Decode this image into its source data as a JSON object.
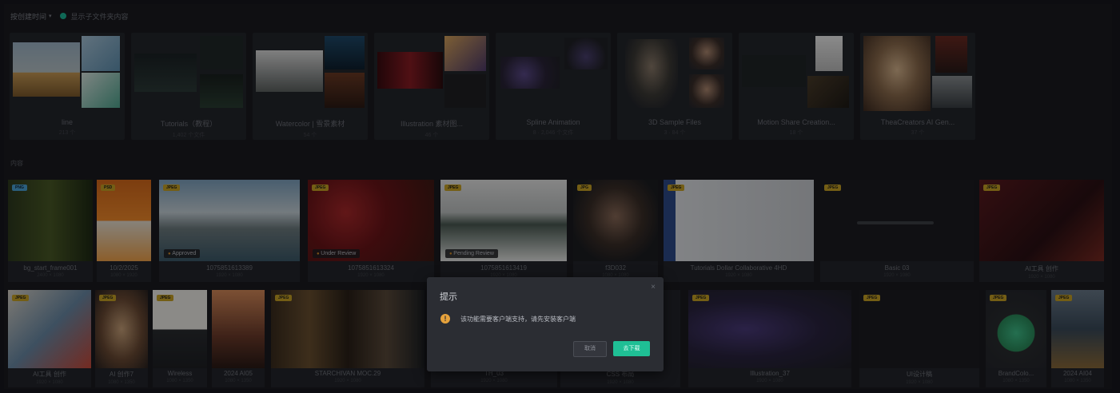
{
  "header": {
    "sort_label": "按创建时间",
    "toggle_label": "显示子文件夹内容"
  },
  "folders": [
    {
      "name": "line",
      "sub": "213 个"
    },
    {
      "name": "Tutorials（教程）",
      "sub": "1,402 个文件"
    },
    {
      "name": "Watercolor | 雪景素材",
      "sub": "54 个"
    },
    {
      "name": "Illustration 素材图...",
      "sub": "46 个"
    },
    {
      "name": "Spline Animation",
      "sub": "8 · 2,046 个文件"
    },
    {
      "name": "3D Sample Files",
      "sub": "3 · 84 个"
    },
    {
      "name": "Motion Share Creation...",
      "sub": "18 个"
    },
    {
      "name": "TheaCreators AI Gen...",
      "sub": "37 个"
    }
  ],
  "section_label": "内容",
  "row1": [
    {
      "badge": "PNG",
      "badge_color": "blue",
      "name": "bg_start_frame001",
      "sub": "2400 × 1080"
    },
    {
      "badge": "PSD",
      "name": "10/2/2025",
      "sub": "1080 × 1920"
    },
    {
      "badge": "JPEG",
      "stat": "Approved",
      "name": "1075851613389",
      "sub": "1920 × 1080"
    },
    {
      "badge": "JPEG",
      "stat": "Under Review",
      "name": "1075851613324",
      "sub": "1920 × 1080"
    },
    {
      "badge": "JPEG",
      "stat": "Pending Review",
      "name": "1075851613419",
      "sub": "1920 × 1080"
    },
    {
      "badge": "JPG",
      "name": "f3D032",
      "sub": "1080 × 1080"
    },
    {
      "badge": "JPEG",
      "name": "Tutorials Dollar Collaborative 4HD",
      "sub": "1920 × 1080"
    },
    {
      "badge": "JPEG",
      "name": "Basic 03",
      "sub": "1920 × 1080"
    },
    {
      "badge": "JPEG",
      "name": "AI工具 创作",
      "sub": "1920 × 1080"
    }
  ],
  "row2": [
    {
      "badge": "JPEG",
      "name": "AI工具 创作",
      "sub": "1920 × 1080"
    },
    {
      "badge": "JPEG",
      "name": "AI 创作7",
      "sub": "1080 × 1350"
    },
    {
      "badge": "JPEG",
      "name": "Wireless",
      "sub": "1080 × 1350"
    },
    {
      "badge": "",
      "name": "2024 AI05",
      "sub": "1080 × 1350"
    },
    {
      "badge": "JPEG",
      "name": "STARCHIVAN MOC.29",
      "sub": "1920 × 1080"
    },
    {
      "badge": "",
      "name": "TH_03",
      "sub": "1920 × 1080"
    },
    {
      "badge": "",
      "name": "CSS 布局",
      "sub": "1920 × 1080"
    },
    {
      "badge": "JPEG",
      "name": "Illustration_37",
      "sub": "1920 × 1080"
    },
    {
      "badge": "JPEG",
      "name": "UI设计稿",
      "sub": "1920 × 1080"
    },
    {
      "badge": "JPEG",
      "name": "BrandColo...",
      "sub": "1080 × 1350"
    },
    {
      "badge": "JPEG",
      "name": "2024 AI04",
      "sub": "1080 × 1350"
    }
  ],
  "dialog": {
    "title": "提示",
    "message": "该功能需要客户端支持，请先安装客户端",
    "cancel_label": "取消",
    "confirm_label": "去下载",
    "warn_icon": "!",
    "close_icon": "×"
  },
  "colors": {
    "accent": "#1fbf95",
    "warning": "#e6a23c",
    "badge": "#c9a325"
  }
}
